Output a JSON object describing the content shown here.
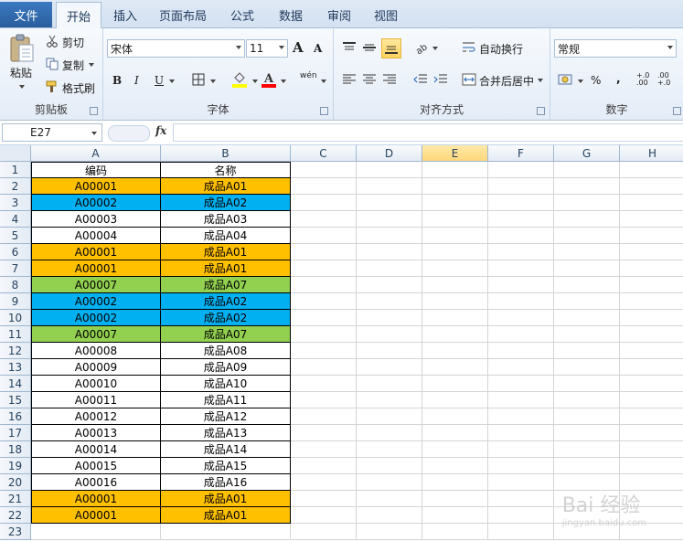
{
  "tabs": [
    "文件",
    "开始",
    "插入",
    "页面布局",
    "公式",
    "数据",
    "审阅",
    "视图"
  ],
  "active_tab": "开始",
  "ribbon": {
    "clipboard": {
      "paste": "粘贴",
      "cut": "剪切",
      "copy": "复制",
      "format_painter": "格式刷",
      "label": "剪贴板"
    },
    "font": {
      "name": "宋体",
      "size": "11",
      "bold": "B",
      "italic": "I",
      "underline": "U",
      "increase": "A",
      "decrease": "A",
      "phonetic": "wén",
      "label": "字体"
    },
    "alignment": {
      "wrap": "自动换行",
      "merge": "合并后居中",
      "label": "对齐方式"
    },
    "number": {
      "format": "常规",
      "percent": "%",
      "comma": ",",
      "increase_decimal": "+.0 .00",
      "decrease_decimal": ".00 +.0",
      "label": "数字"
    }
  },
  "formula_bar": {
    "name_box": "E27",
    "fx": "fx",
    "formula": ""
  },
  "columns": [
    "A",
    "B",
    "C",
    "D",
    "E",
    "F",
    "G",
    "H"
  ],
  "selected_column": "E",
  "rows": [
    {
      "n": "1",
      "a": "编码",
      "b": "名称",
      "fill": "#ffffff"
    },
    {
      "n": "2",
      "a": "A00001",
      "b": "成品A01",
      "fill": "#ffc000"
    },
    {
      "n": "3",
      "a": "A00002",
      "b": "成品A02",
      "fill": "#00b0f0"
    },
    {
      "n": "4",
      "a": "A00003",
      "b": "成品A03",
      "fill": "#ffffff"
    },
    {
      "n": "5",
      "a": "A00004",
      "b": "成品A04",
      "fill": "#ffffff"
    },
    {
      "n": "6",
      "a": "A00001",
      "b": "成品A01",
      "fill": "#ffc000"
    },
    {
      "n": "7",
      "a": "A00001",
      "b": "成品A01",
      "fill": "#ffc000"
    },
    {
      "n": "8",
      "a": "A00007",
      "b": "成品A07",
      "fill": "#92d050"
    },
    {
      "n": "9",
      "a": "A00002",
      "b": "成品A02",
      "fill": "#00b0f0"
    },
    {
      "n": "10",
      "a": "A00002",
      "b": "成品A02",
      "fill": "#00b0f0"
    },
    {
      "n": "11",
      "a": "A00007",
      "b": "成品A07",
      "fill": "#92d050"
    },
    {
      "n": "12",
      "a": "A00008",
      "b": "成品A08",
      "fill": "#ffffff"
    },
    {
      "n": "13",
      "a": "A00009",
      "b": "成品A09",
      "fill": "#ffffff"
    },
    {
      "n": "14",
      "a": "A00010",
      "b": "成品A10",
      "fill": "#ffffff"
    },
    {
      "n": "15",
      "a": "A00011",
      "b": "成品A11",
      "fill": "#ffffff"
    },
    {
      "n": "16",
      "a": "A00012",
      "b": "成品A12",
      "fill": "#ffffff"
    },
    {
      "n": "17",
      "a": "A00013",
      "b": "成品A13",
      "fill": "#ffffff"
    },
    {
      "n": "18",
      "a": "A00014",
      "b": "成品A14",
      "fill": "#ffffff"
    },
    {
      "n": "19",
      "a": "A00015",
      "b": "成品A15",
      "fill": "#ffffff"
    },
    {
      "n": "20",
      "a": "A00016",
      "b": "成品A16",
      "fill": "#ffffff"
    },
    {
      "n": "21",
      "a": "A00001",
      "b": "成品A01",
      "fill": "#ffc000"
    },
    {
      "n": "22",
      "a": "A00001",
      "b": "成品A01",
      "fill": "#ffc000"
    },
    {
      "n": "23",
      "a": "",
      "b": "",
      "fill": "#ffffff"
    }
  ],
  "watermark": {
    "brand": "Bai 经验",
    "url": "jingyan.baidu.com"
  }
}
